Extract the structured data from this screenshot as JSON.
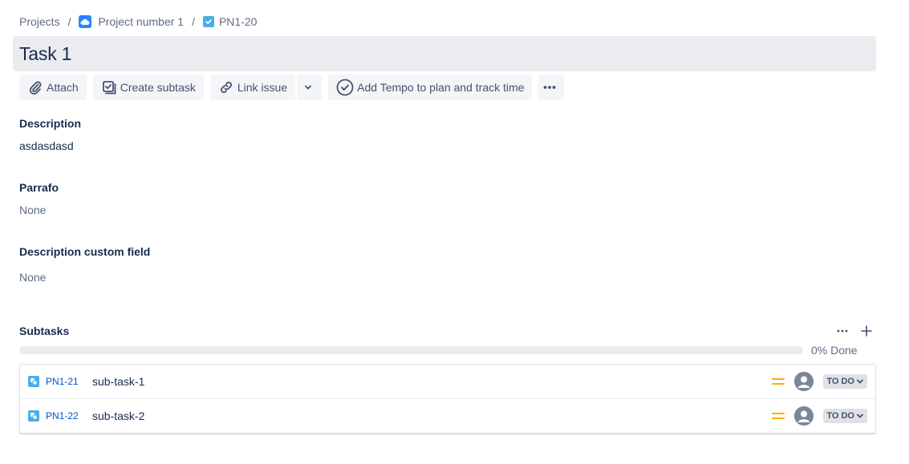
{
  "breadcrumb": {
    "projects": "Projects",
    "project": "Project number 1",
    "issue_key": "PN1-20",
    "separator": "/"
  },
  "issue": {
    "title": "Task 1"
  },
  "toolbar": {
    "attach": "Attach",
    "create_subtask": "Create subtask",
    "link_issue": "Link issue",
    "tempo": "Add Tempo to plan and track time"
  },
  "fields": {
    "description": {
      "label": "Description",
      "value": "asdasdasd"
    },
    "parrafo": {
      "label": "Parrafo",
      "value": "None"
    },
    "description_custom": {
      "label": "Description custom field",
      "value": "None"
    }
  },
  "subtasks": {
    "title": "Subtasks",
    "progress_percent": 0,
    "progress_text": "0% Done",
    "items": [
      {
        "key": "PN1-21",
        "summary": "sub-task-1",
        "status": "TO DO",
        "priority": "medium"
      },
      {
        "key": "PN1-22",
        "summary": "sub-task-2",
        "status": "TO DO",
        "priority": "medium"
      }
    ]
  },
  "colors": {
    "link": "#0052cc",
    "priority_medium": "#ffab00",
    "issue_type": "#4bade8"
  }
}
